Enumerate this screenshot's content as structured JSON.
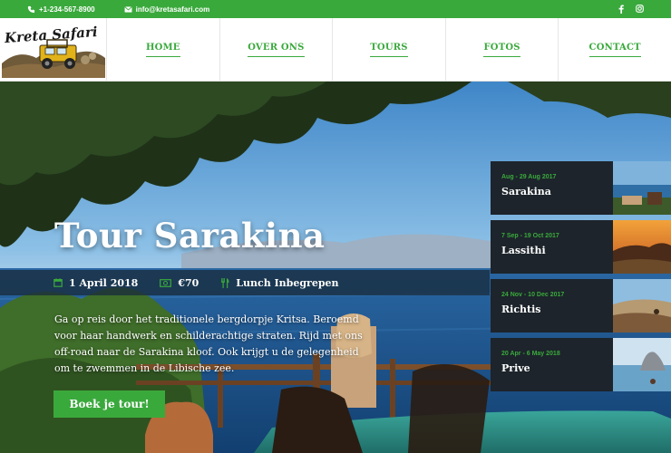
{
  "topbar": {
    "phone": "+1-234-567-8900",
    "email": "info@kretasafari.com",
    "social": [
      "facebook-icon",
      "instagram-icon"
    ]
  },
  "brand": {
    "logo_text": "Kreta Safari"
  },
  "nav": [
    {
      "label": "HOME"
    },
    {
      "label": "OVER ONS"
    },
    {
      "label": "TOURS"
    },
    {
      "label": "FOTOS"
    },
    {
      "label": "CONTACT"
    }
  ],
  "hero": {
    "title": "Tour Sarakina",
    "date": "1 April 2018",
    "price": "€70",
    "meal": "Lunch Inbegrepen",
    "description": "Ga op reis door het traditionele bergdorpje Kritsa. Beroemd voor haar handwerk en schilderachtige straten. Rijd met ons off-road naar de Sarakina kloof. Ook krijgt u de gelegenheid om te zwemmen in de Libische zee.",
    "cta_label": "Boek je tour!"
  },
  "tours": [
    {
      "dates": "Aug - 29 Aug 2017",
      "name": "Sarakina"
    },
    {
      "dates": "7 Sep - 19 Oct 2017",
      "name": "Lassithi"
    },
    {
      "dates": "24 Nov - 10 Dec 2017",
      "name": "Richtis"
    },
    {
      "dates": "20 Apr - 6 May 2018",
      "name": "Prive"
    }
  ],
  "colors": {
    "accent": "#3aa93c",
    "dark_card": "#1d242b"
  }
}
